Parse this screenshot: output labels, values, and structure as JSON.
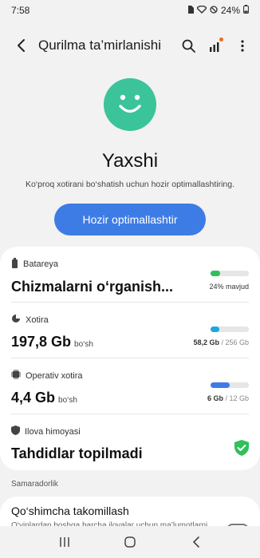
{
  "status_bar": {
    "time": "7:58",
    "battery_pct": "24%",
    "icons": [
      "sim-icon",
      "wifi-icon",
      "dnd-icon",
      "battery-icon"
    ]
  },
  "app_bar": {
    "title": "Qurilma ta’mirlanishi",
    "actions": [
      "search-icon",
      "signal-bars-icon",
      "more-vert-icon"
    ]
  },
  "hero": {
    "status_title": "Yaxshi",
    "status_subtitle": "Ko‘proq xotirani bo‘shatish uchun hozir optimallashtiring.",
    "optimize_label": "Hozir optimallashtir",
    "accent": "#3e7ce5",
    "smiley_color": "#3bc499"
  },
  "items": {
    "battery": {
      "label": "Batareya",
      "value": "Chizmalarni o‘rganish...",
      "caption": "24% mavjud",
      "fill_fraction": 0.24,
      "color": "#2fc05a"
    },
    "storage": {
      "label": "Xotira",
      "value": "197,8 Gb",
      "unit": "bo‘sh",
      "caption_used": "58,2 Gb",
      "caption_total": "/ 256 Gb",
      "fill_fraction": 0.23,
      "color": "#1aa8e0"
    },
    "ram": {
      "label": "Operativ xotira",
      "value": "4,4 Gb",
      "unit": "bo‘sh",
      "caption_used": "6 Gb",
      "caption_total": "/ 12 Gb",
      "fill_fraction": 0.5,
      "color": "#3e7ce5"
    },
    "protection": {
      "label": "Ilova himoyasi",
      "value": "Tahdidlar topilmadi",
      "color": "#2fc05a"
    }
  },
  "section_label": "Samaradorlik",
  "performance": {
    "title": "Qo‘shimcha takomillash",
    "desc": "O‘yinlardan boshqa barcha ilovalar uchun ma’lumotlarni tezkor qayta ishlang. Ko‘proq batareya quvvatini",
    "toggle_on": false
  },
  "nav": [
    "recents-icon",
    "home-icon",
    "back-icon"
  ]
}
